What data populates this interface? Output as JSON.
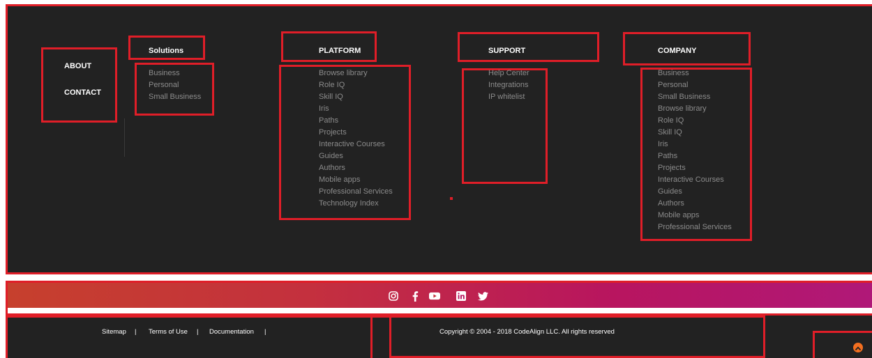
{
  "footer": {
    "primary_links": [
      "ABOUT",
      "CONTACT"
    ],
    "solutions": {
      "heading": "Solutions",
      "items": [
        "Business",
        "Personal",
        "Small Business"
      ]
    },
    "platform": {
      "heading": "PLATFORM",
      "items": [
        "Browse library",
        "Role IQ",
        "Skill IQ",
        "Iris",
        "Paths",
        "Projects",
        "Interactive Courses",
        "Guides",
        "Authors",
        "Mobile apps",
        "Professional Services",
        "Technology Index"
      ]
    },
    "support": {
      "heading": "SUPPORT",
      "items": [
        "Help Center",
        "Integrations",
        "IP whitelist"
      ]
    },
    "company": {
      "heading": "COMPANY",
      "items": [
        "Business",
        "Personal",
        "Small Business",
        "Browse library",
        "Role IQ",
        "Skill IQ",
        "Iris",
        "Paths",
        "Projects",
        "Interactive Courses",
        "Guides",
        "Authors",
        "Mobile apps",
        "Professional Services"
      ]
    }
  },
  "social": {
    "icons": [
      "instagram-icon",
      "facebook-icon",
      "youtube-icon",
      "linkedin-icon",
      "twitter-icon"
    ]
  },
  "bottom_bar": {
    "links": [
      "Sitemap",
      "Terms of Use",
      "Documentation"
    ],
    "separator": "|",
    "copyright": "Copyright © 2004 - 2018 CodeAlign LLC. All rights reserved"
  },
  "colors": {
    "footer_bg": "#222222",
    "link_gray": "#8c8c8c",
    "outline_red": "#e01e28",
    "gradient_start": "#c6402d",
    "gradient_end": "#b01878",
    "scroll_top": "#f36f20"
  }
}
